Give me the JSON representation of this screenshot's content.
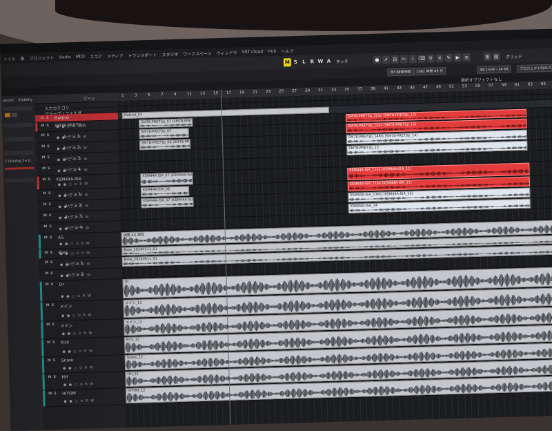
{
  "menu": [
    "ァイル",
    "集",
    "プロジェクト",
    "Audio",
    "MIDI",
    "スコア",
    "メディア",
    "トランスポート",
    "スタジオ",
    "ワークスペース",
    "ウィンドウ",
    "VST Cloud",
    "Hub",
    "ヘルプ"
  ],
  "toolbar": {
    "modes": [
      "M",
      "S",
      "L",
      "R",
      "W",
      "A"
    ],
    "touch_label": "タッチ",
    "grid_label": "グリッド"
  },
  "infobar": {
    "record_time_label": "残り録音時間",
    "record_time_value": "1081 時間 49 分",
    "sample_rate": "44.1 kHz - 24 bit",
    "project_panner": "プロジェクト内のパンナー",
    "selection": "選択オブジェクトなし"
  },
  "inspector": {
    "tab_inspector": "pector",
    "tab_visibility": "Visibility",
    "routing_text": "2 (Analog 3+1)"
  },
  "tracklist_header": "ゾーン",
  "tracks": [
    {
      "name": "入力カテゴリ"
    },
    {
      "name": "グループ / フォルダ"
    },
    {
      "name": "Hat(m)",
      "selected": true
    },
    {
      "name": "SM78-PRE73p"
    },
    {
      "name": "レーン 1"
    },
    {
      "name": "レーン 2"
    },
    {
      "name": "レーン 3"
    },
    {
      "name": "レーン 4"
    },
    {
      "name": "KSM44A-ISA"
    },
    {
      "name": "レーン 1"
    },
    {
      "name": "レーン 2"
    },
    {
      "name": "レーン 3"
    },
    {
      "name": "レーン 4"
    },
    {
      "name": "AG"
    },
    {
      "name": "Bass"
    },
    {
      "name": "レーン 1"
    },
    {
      "name": "レーン 2"
    },
    {
      "name": "Dr"
    },
    {
      "name": "メイン"
    },
    {
      "name": "メイン"
    },
    {
      "name": "Kick"
    },
    {
      "name": "Snare"
    },
    {
      "name": "HH"
    },
    {
      "name": "HiTOM"
    }
  ],
  "ruler_bars": [
    "1",
    "3",
    "5",
    "7",
    "9",
    "11",
    "13",
    "15",
    "17",
    "19",
    "21",
    "23",
    "25",
    "27",
    "29",
    "31",
    "33",
    "35",
    "37",
    "39",
    "41",
    "43",
    "45",
    "47",
    "49",
    "51",
    "53",
    "55",
    "57",
    "59",
    "61",
    "63",
    "65"
  ],
  "events": [
    {
      "label": "Hat(m)_01"
    },
    {
      "label": "SM78-PRE73p_07 (SM78-PRE73p_07)"
    },
    {
      "label": "SM78-PRE73p_07"
    },
    {
      "label": "SM78-PRE73p_08 (SM78-PRE73p_08)"
    },
    {
      "label": "SM78-PRE73p_12ex (SM78-PRE73p_12)"
    },
    {
      "label": "SM78-PRE73p_12ex (SM78-PRE73p_12)"
    },
    {
      "label": "SM78-PRE73p_14RG (SM78-PRE73p_14)"
    },
    {
      "label": "SM78-PRE73p_15"
    },
    {
      "label": "KSM44A-ISA_07 (KSM44A-ISA_07ex)"
    },
    {
      "label": "KSM44A-ISA_06"
    },
    {
      "label": "KSM44A-ISA_07 (KSM44A-ISA_07ex)"
    },
    {
      "label": "KSM44A-ISA_11ex (KSM44A-ISA_11)"
    },
    {
      "label": "KSM44A-ISA_11ex (KSM44A-ISA_11)"
    },
    {
      "label": "KSM44A-ISA_13RG (KSM44A-ISA_13)"
    },
    {
      "label": "KSM44A-ISA_14"
    },
    {
      "label": "調整 AG 録音"
    },
    {
      "label": "Bass_20240511_01"
    },
    {
      "label": "Bass_20240511_01"
    },
    {
      "label": "Dr"
    },
    {
      "label": "メイン_12"
    },
    {
      "label": "メイン_12"
    },
    {
      "label": "Kick_12"
    },
    {
      "label": "Snare_12"
    },
    {
      "label": "HH_12"
    },
    {
      "label": "HiTOM_12"
    }
  ],
  "colors": {
    "selected_track": "#c9333a",
    "red_event": "#e23c3c",
    "mode_active": "#e8d21a"
  }
}
